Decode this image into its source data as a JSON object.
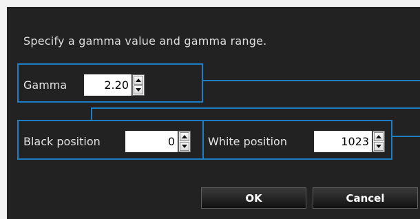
{
  "instruction": "Specify a gamma value and gamma range.",
  "gamma": {
    "label": "Gamma",
    "value": "2.20"
  },
  "black_position": {
    "label": "Black position",
    "value": "0"
  },
  "white_position": {
    "label": "White position",
    "value": "1023"
  },
  "buttons": {
    "ok": "OK",
    "cancel": "Cancel"
  },
  "colors": {
    "background": "#222222",
    "accent_border": "#1c7fc4",
    "text": "#e2e2e2"
  },
  "icons": {
    "spin_up": "arrow-up-icon",
    "spin_down": "arrow-down-icon"
  }
}
